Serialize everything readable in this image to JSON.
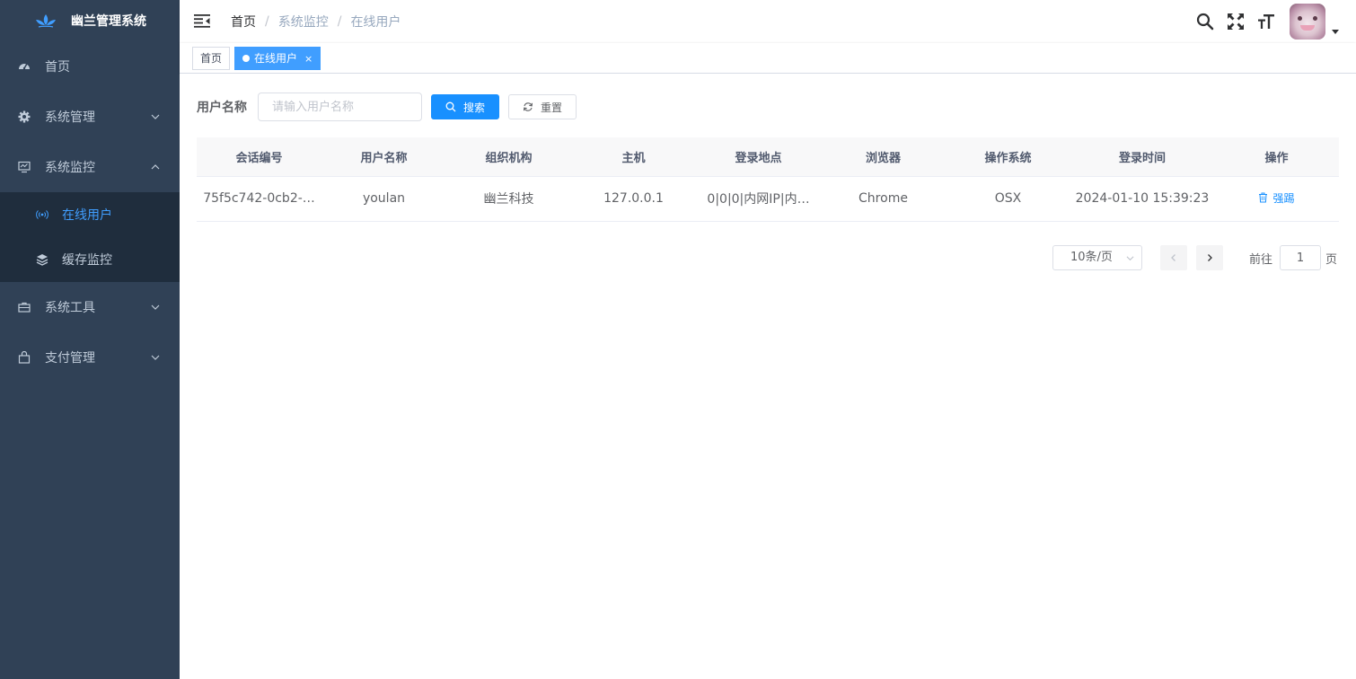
{
  "app": {
    "title": "幽兰管理系统"
  },
  "sidebar": {
    "items": [
      {
        "label": "首页"
      },
      {
        "label": "系统管理"
      },
      {
        "label": "系统监控"
      },
      {
        "label": "系统工具"
      },
      {
        "label": "支付管理"
      }
    ],
    "monitor_sub": [
      {
        "label": "在线用户",
        "active": true
      },
      {
        "label": "缓存监控",
        "active": false
      }
    ]
  },
  "breadcrumb": [
    "首页",
    "系统监控",
    "在线用户"
  ],
  "tags": [
    {
      "label": "首页",
      "active": false
    },
    {
      "label": "在线用户",
      "active": true,
      "close": "×"
    }
  ],
  "search": {
    "label": "用户名称",
    "value": "",
    "placeholder": "请输入用户名称",
    "search_label": "搜索",
    "reset_label": "重置"
  },
  "table": {
    "columns": [
      "会话编号",
      "用户名称",
      "组织机构",
      "主机",
      "登录地点",
      "浏览器",
      "操作系统",
      "登录时间",
      "操作"
    ],
    "rows": [
      {
        "session_id": "75f5c742-0cb2-…",
        "username": "youlan",
        "org": "幽兰科技",
        "host": "127.0.0.1",
        "location": "0|0|0|内网IP|内…",
        "browser": "Chrome",
        "os": "OSX",
        "login_time": "2024-01-10 15:39:23",
        "action": "强踢"
      }
    ]
  },
  "pagination": {
    "page_size": "10条/页",
    "goto_label": "前往",
    "page": "1",
    "page_suffix": "页"
  },
  "colors": {
    "sidebar_bg": "#304156",
    "submenu_bg": "#1f2d3d",
    "accent": "#409eff",
    "primary_button": "#1890ff"
  },
  "icons": {
    "logo": "orchid-logo-icon",
    "home": "dashboard-icon",
    "system": "gear-icon",
    "monitor": "monitor-icon",
    "online": "broadcast-icon",
    "cache": "layers-icon",
    "tool": "toolbox-icon",
    "pay": "bag-icon",
    "search": "search-icon",
    "fullscreen": "fullscreen-icon",
    "size": "font-size-icon"
  }
}
